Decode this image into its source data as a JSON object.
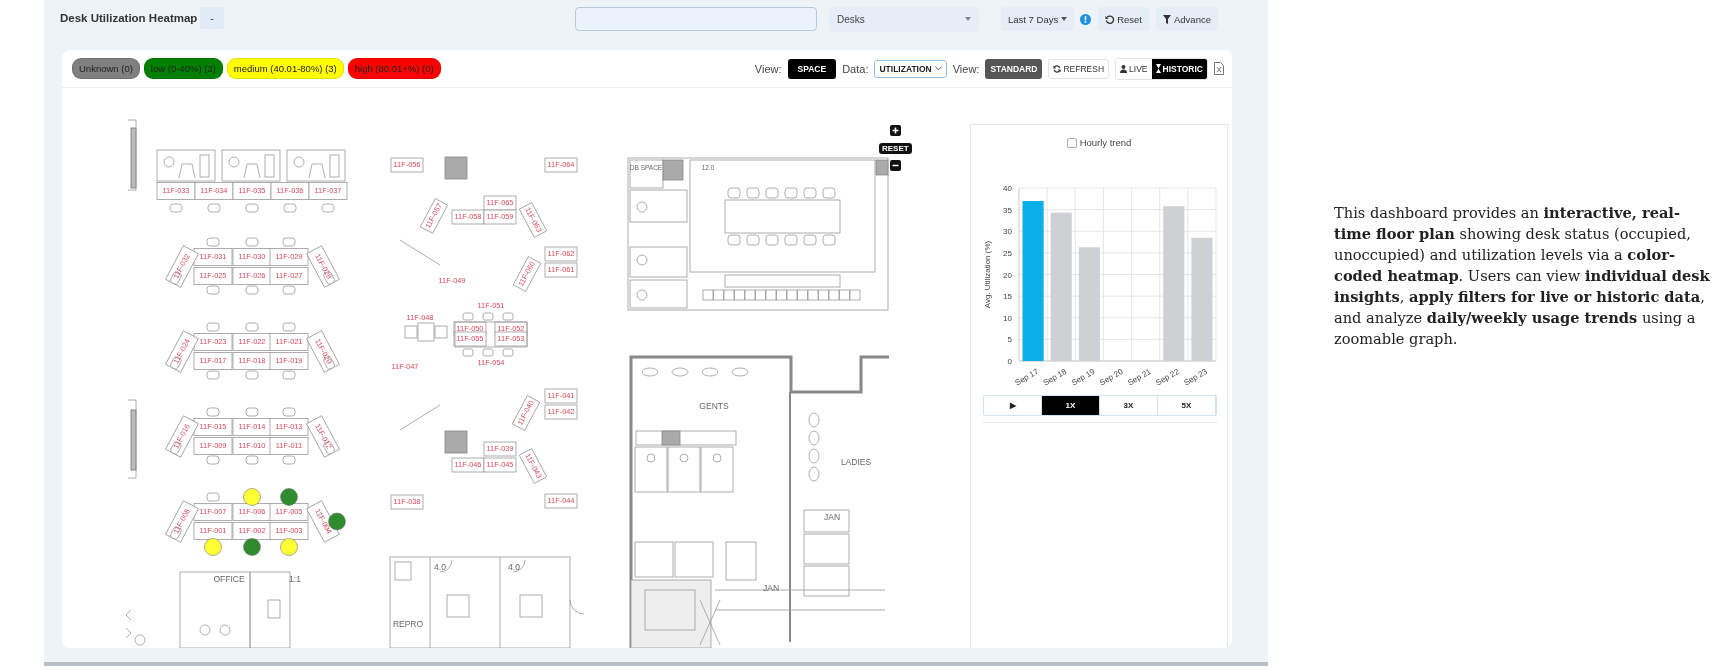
{
  "header": {
    "title": "Desk Utilization Heatmap",
    "collapse_button": "-",
    "space_select": "Desks",
    "date_range": "Last 7 Days",
    "reset_button": "Reset",
    "advance_button": "Advance"
  },
  "legend": [
    {
      "label": "Unknown (0)",
      "color": "#808080"
    },
    {
      "label": "low (0-40%) (3)",
      "color": "#008000"
    },
    {
      "label": "medium (40.01-80%) (3)",
      "color": "#ffff00"
    },
    {
      "label": "high (80.01+%) (0)",
      "color": "#ff0000"
    }
  ],
  "toolbar": {
    "view_label": "View:",
    "view_button": "SPACE",
    "data_label": "Data:",
    "data_select": "UTILIZATION",
    "view2_label": "View:",
    "standard_button": "STANDARD",
    "refresh_button": "REFRESH",
    "modes": [
      {
        "label": "LIVE",
        "selected": false
      },
      {
        "label": "HISTORIC",
        "selected": true
      }
    ]
  },
  "floor_plan": {
    "zoom_reset": "RESET",
    "desks": [
      {
        "label": "11F-033"
      },
      {
        "label": "11F-034"
      },
      {
        "label": "11F-035"
      },
      {
        "label": "11F-036"
      },
      {
        "label": "11F-037"
      },
      {
        "label": "11F-031"
      },
      {
        "label": "11F-030"
      },
      {
        "label": "11F-029"
      },
      {
        "label": "11F-032"
      },
      {
        "label": "11F-028"
      },
      {
        "label": "11F-025"
      },
      {
        "label": "11F-026"
      },
      {
        "label": "11F-027"
      },
      {
        "label": "11F-023"
      },
      {
        "label": "11F-022"
      },
      {
        "label": "11F-021"
      },
      {
        "label": "11F-024"
      },
      {
        "label": "11F-020"
      },
      {
        "label": "11F-017"
      },
      {
        "label": "11F-018"
      },
      {
        "label": "11F-019"
      },
      {
        "label": "11F-015"
      },
      {
        "label": "11F-014"
      },
      {
        "label": "11F-013"
      },
      {
        "label": "11F-016"
      },
      {
        "label": "11F-012"
      },
      {
        "label": "11F-009"
      },
      {
        "label": "11F-010"
      },
      {
        "label": "11F-011"
      },
      {
        "label": "11F-007"
      },
      {
        "label": "11F-006",
        "color": "#ffff33"
      },
      {
        "label": "11F-005",
        "color": "#2e8b2e"
      },
      {
        "label": "11F-008"
      },
      {
        "label": "11F-004",
        "color": "#2e8b2e"
      },
      {
        "label": "11F-001",
        "color": "#ffff33"
      },
      {
        "label": "11F-002",
        "color": "#2e8b2e"
      },
      {
        "label": "11F-003",
        "color": "#ffff33"
      },
      {
        "label": "11F-056"
      },
      {
        "label": "11F-064"
      },
      {
        "label": "11F-065"
      },
      {
        "label": "11F-057"
      },
      {
        "label": "11F-058"
      },
      {
        "label": "11F-059"
      },
      {
        "label": "11F-063"
      },
      {
        "label": "11F-062"
      },
      {
        "label": "11F-061"
      },
      {
        "label": "11F-060"
      },
      {
        "label": "11F-049"
      },
      {
        "label": "11F-051"
      },
      {
        "label": "11F-048"
      },
      {
        "label": "11F-050"
      },
      {
        "label": "11F-052"
      },
      {
        "label": "11F-055"
      },
      {
        "label": "11F-053"
      },
      {
        "label": "11F-054"
      },
      {
        "label": "11F-047"
      },
      {
        "label": "11F-041"
      },
      {
        "label": "11F-042"
      },
      {
        "label": "11F-040"
      },
      {
        "label": "11F-039"
      },
      {
        "label": "11F-046"
      },
      {
        "label": "11F-045"
      },
      {
        "label": "11F-043"
      },
      {
        "label": "11F-038"
      },
      {
        "label": "11F-044"
      }
    ],
    "rooms": [
      {
        "label": "DB SPACE"
      },
      {
        "label": "12.0"
      },
      {
        "label": "GENTS"
      },
      {
        "label": "LADIES"
      },
      {
        "label": "JAN"
      },
      {
        "label": "JAN"
      },
      {
        "label": "4.0"
      },
      {
        "label": "4.0"
      },
      {
        "label": "REPRO"
      },
      {
        "label": "OFFICE"
      },
      {
        "label": "1:1"
      }
    ]
  },
  "trend_panel": {
    "hourly_trend": {
      "label": "Hourly trend",
      "checked": false
    },
    "chart_data": {
      "type": "bar",
      "grid": true,
      "ylabel": "Avg. Utilization (%)",
      "categories": [
        "Sep 17",
        "Sep 18",
        "Sep 19",
        "Sep 20",
        "Sep 21",
        "Sep 22",
        "Sep 23"
      ],
      "stacked": true,
      "ylim": [
        0,
        40
      ],
      "yticks": [
        0,
        5,
        10,
        15,
        20,
        25,
        30,
        35,
        40
      ],
      "series": [
        {
          "color": "#0aaee8",
          "values": [
            37,
            null,
            null,
            null,
            null,
            null,
            null
          ]
        },
        {
          "color": "#cfd0d3",
          "values": [
            null,
            34.3,
            26.3,
            null,
            null,
            35.8,
            28.5
          ]
        }
      ]
    },
    "speeds": [
      {
        "label": "▶",
        "selected": false
      },
      {
        "label": "1X",
        "selected": true
      },
      {
        "label": "3X",
        "selected": false
      },
      {
        "label": "5X",
        "selected": false
      }
    ]
  },
  "description": "This dashboard provides an **interactive, real-time floor plan** showing desk status (occupied, unoccupied) and utilization levels via a **color-coded heatmap**. Users can view **individual desk insights**, **apply filters for live or historic data**, and analyze **daily/weekly usage trends** using a zoomable graph."
}
